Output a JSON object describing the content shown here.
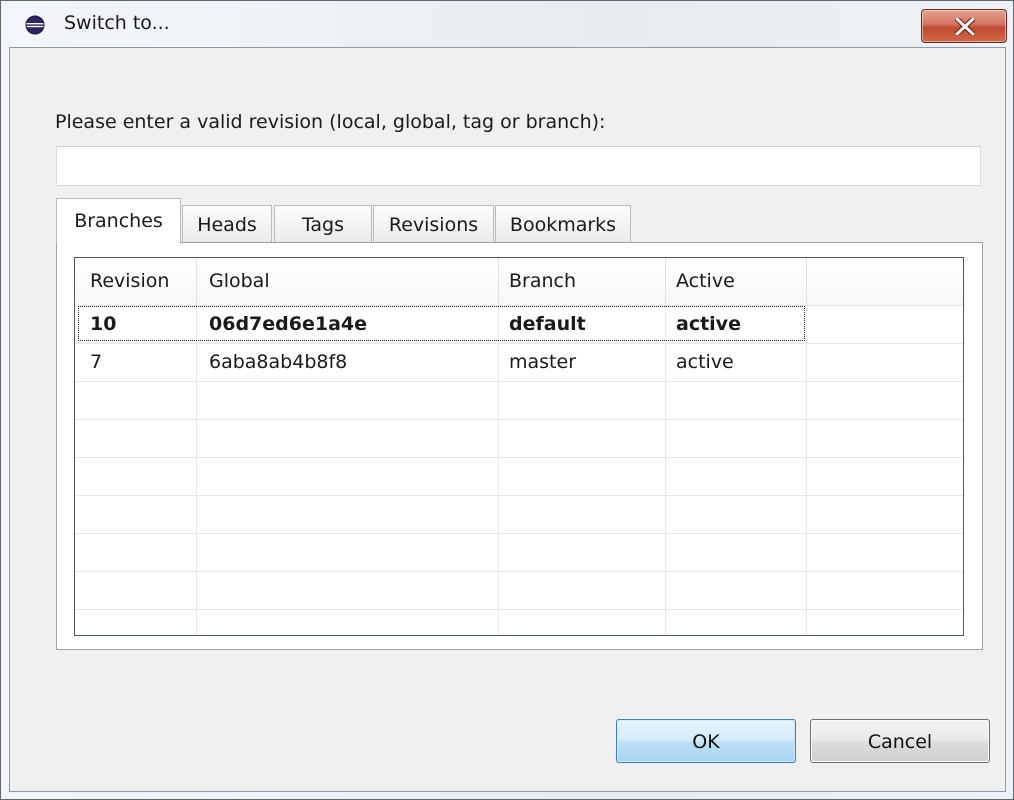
{
  "window": {
    "title": "Switch to...",
    "close_symbol": "X"
  },
  "prompt": {
    "label": "Please enter a valid revision (local, global, tag or branch):",
    "value": "",
    "placeholder": ""
  },
  "tabs": [
    {
      "label": "Branches",
      "active": true
    },
    {
      "label": "Heads",
      "active": false
    },
    {
      "label": "Tags",
      "active": false
    },
    {
      "label": "Revisions",
      "active": false
    },
    {
      "label": "Bookmarks",
      "active": false
    }
  ],
  "table": {
    "columns": [
      "Revision",
      "Global",
      "Branch",
      "Active"
    ],
    "rows": [
      {
        "revision": "10",
        "global": "06d7ed6e1a4e",
        "branch": "default",
        "active": "active",
        "bold": true
      },
      {
        "revision": "7",
        "global": "6aba8ab4b8f8",
        "branch": "master",
        "active": "active",
        "bold": false
      }
    ]
  },
  "buttons": {
    "ok": "OK",
    "cancel": "Cancel"
  }
}
